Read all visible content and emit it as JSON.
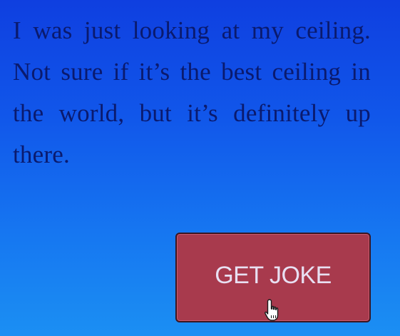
{
  "joke": {
    "text": "I was just looking at my ceiling. Not sure if it’s the best ceiling in the world, but it’s definitely up there."
  },
  "button": {
    "label": "GET JOKE"
  },
  "cursor": {
    "icon": "hand-pointer-icon"
  },
  "colors": {
    "background_top": "#0f3fe0",
    "background_bottom": "#1b8ff3",
    "text": "#0a1a6e",
    "button_fill": "#a83a4d",
    "button_label": "#e8e0f2"
  }
}
